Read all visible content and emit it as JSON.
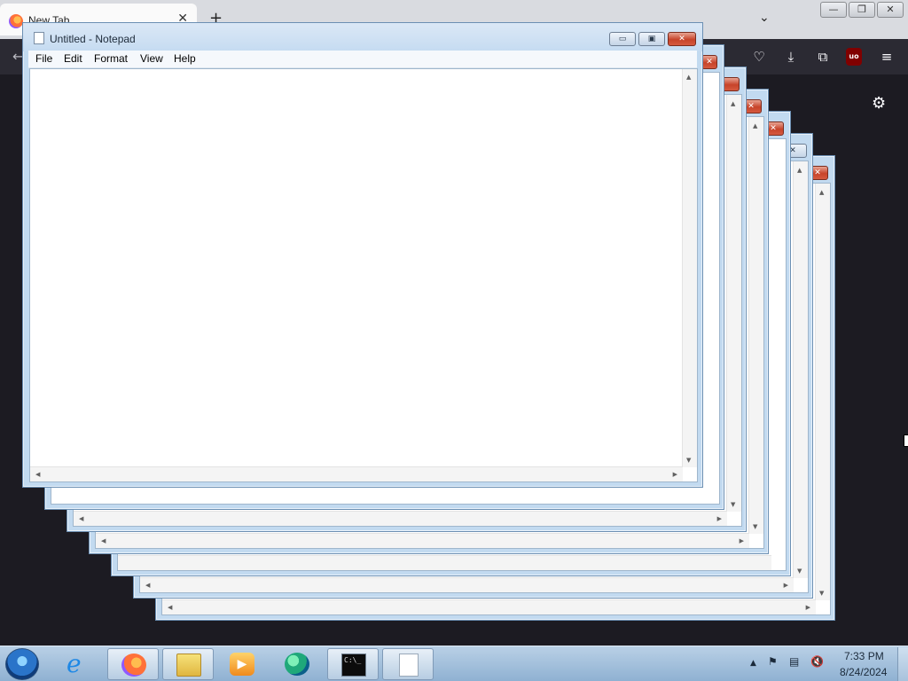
{
  "browser": {
    "tab_title": "New Tab",
    "tab_close_glyph": "✕",
    "new_tab_glyph": "+",
    "list_tabs_glyph": "⌄",
    "window_controls": [
      "—",
      "❐",
      "✕"
    ],
    "toolbar_icons": [
      "pocket-icon",
      "download-icon",
      "extensions-icon",
      "ublock-icon",
      "menu-icon"
    ],
    "ublock_label": "uo",
    "settings_glyph": "⚙"
  },
  "notepad": {
    "title": "Untitled - Notepad",
    "menu": [
      "File",
      "Edit",
      "Format",
      "View",
      "Help"
    ],
    "minimize_glyph": "▭",
    "maximize_glyph": "▣",
    "close_glyph": "✕",
    "stacked_window_count": 5
  },
  "taskbar": {
    "pinned": [
      "start-orb",
      "internet-explorer",
      "firefox",
      "file-explorer",
      "media-player",
      "edge",
      "command-prompt",
      "notepad"
    ],
    "tray_glyphs": [
      "▲",
      "⚑",
      "▤",
      "🔇"
    ],
    "time": "7:33 PM",
    "date": "8/24/2024"
  },
  "colors": {
    "firefox_dark": "#1c1b22",
    "firefox_toolbar": "#2b2a33",
    "aero_frame": "#c2daf0",
    "close_red": "#c7432a",
    "taskbar": "#a6c3de"
  }
}
